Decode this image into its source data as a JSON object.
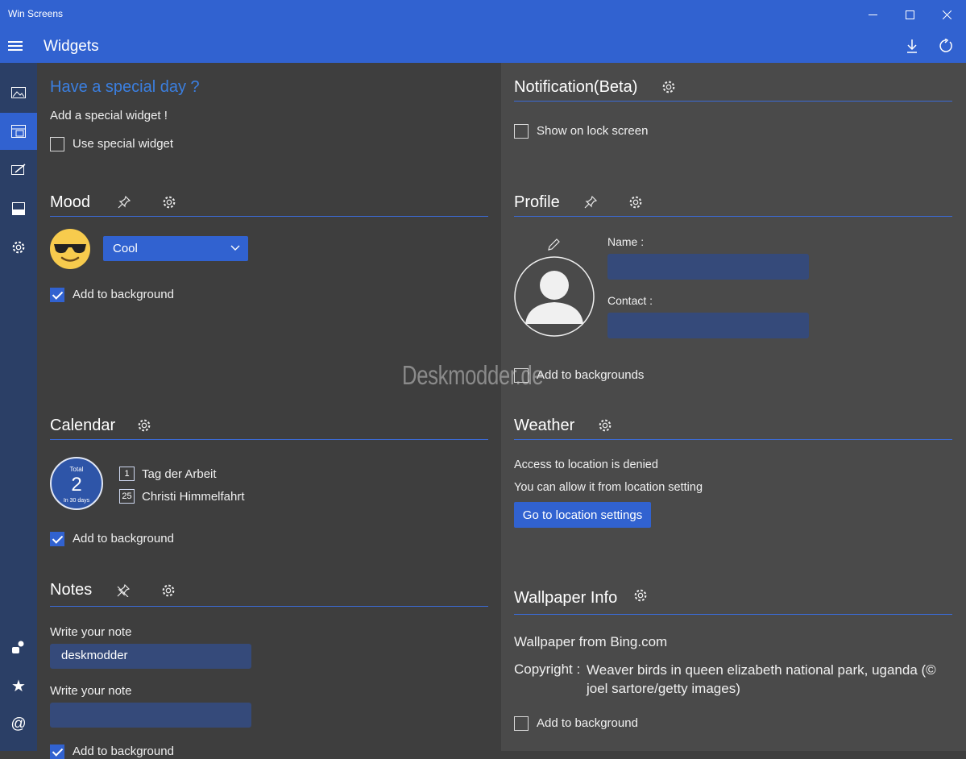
{
  "window": {
    "title": "Win Screens"
  },
  "header": {
    "title": "Widgets"
  },
  "special": {
    "title": "Have a special day ?",
    "subtitle": "Add a special widget !",
    "checkbox_label": "Use special widget"
  },
  "mood": {
    "title": "Mood",
    "selected": "Cool",
    "add_bg": "Add to background"
  },
  "calendar": {
    "title": "Calendar",
    "total_label": "Total",
    "total_value": "2",
    "period_label": "In 30 days",
    "events": [
      {
        "day": "1",
        "name": "Tag der Arbeit"
      },
      {
        "day": "25",
        "name": "Christi Himmelfahrt"
      }
    ],
    "add_bg": "Add to background"
  },
  "notes": {
    "title": "Notes",
    "label1": "Write your note",
    "value1": "deskmodder",
    "label2": "Write your note",
    "value2": "",
    "add_bg": "Add to background"
  },
  "notification": {
    "title": "Notification(Beta)",
    "checkbox_label": "Show on lock screen"
  },
  "profile": {
    "title": "Profile",
    "name_label": "Name :",
    "contact_label": "Contact :",
    "add_bg": "Add to backgrounds"
  },
  "weather": {
    "title": "Weather",
    "line1": "Access to location is denied",
    "line2": "You can allow it from location setting",
    "button": "Go to location settings"
  },
  "wallpaper": {
    "title": "Wallpaper Info",
    "source": "Wallpaper from Bing.com",
    "copyright_label": "Copyright :",
    "copyright_text_1": "Weaver birds in queen elizabeth national park, uganda (©",
    "copyright_text_2": "joel sartore/getty images)",
    "add_bg": "Add to background"
  },
  "watermark": "Deskmodder.de",
  "colors": {
    "accent": "#3162d0",
    "sidebar": "#2b3f66",
    "left_bg": "#3e3e3e",
    "right_bg": "#4a4a4a",
    "link": "#3b7fe0"
  }
}
